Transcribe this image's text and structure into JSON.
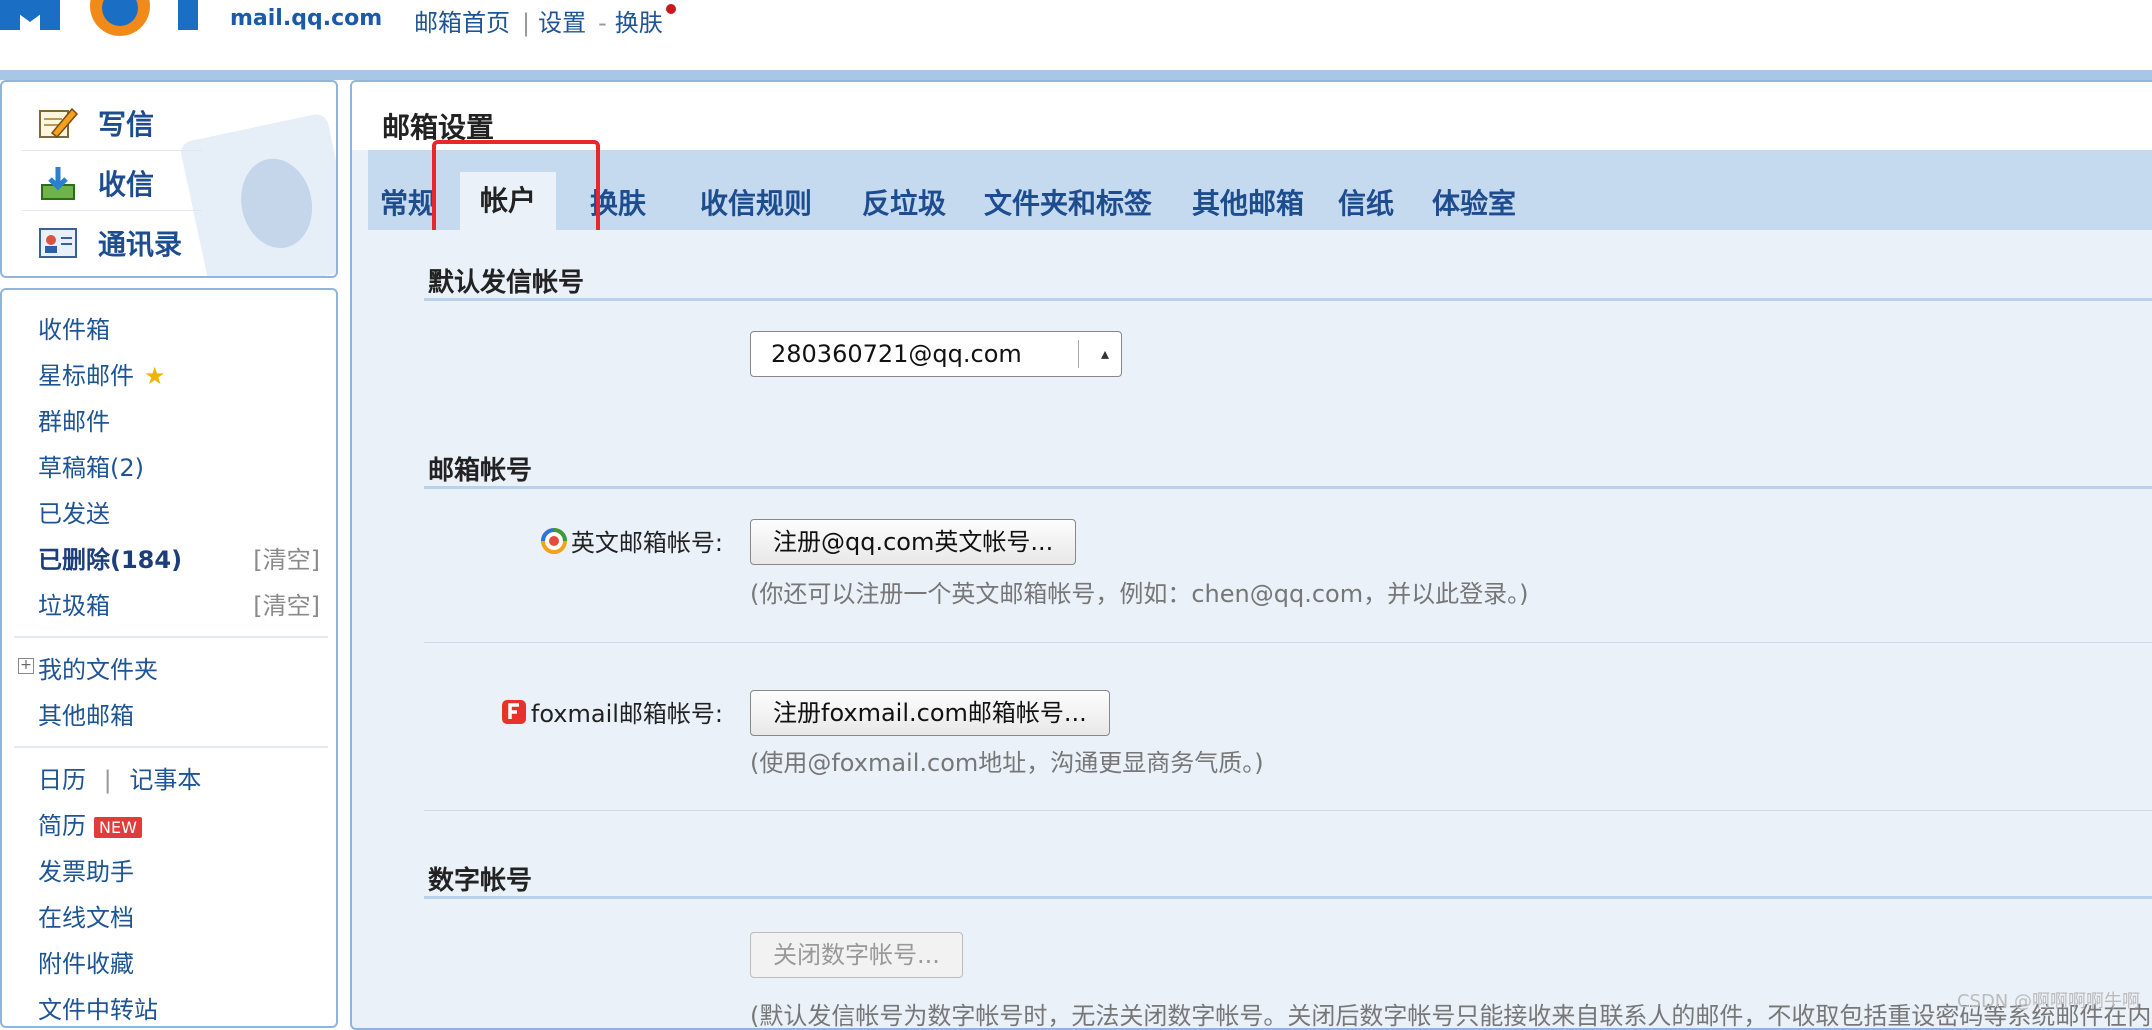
{
  "header": {
    "logo_text": "mail.qq.com",
    "links": [
      "邮箱首页",
      "设置",
      "换肤"
    ]
  },
  "quick": {
    "compose": "写信",
    "receive": "收信",
    "contacts": "通讯录"
  },
  "nav": {
    "inbox": "收件箱",
    "starred": "星标邮件",
    "group": "群邮件",
    "drafts": "草稿箱(2)",
    "sent": "已发送",
    "deleted": "已删除(184)",
    "deleted_clear": "[清空]",
    "spam": "垃圾箱",
    "spam_clear": "[清空]",
    "my_folders": "我的文件夹",
    "other_mail": "其他邮箱",
    "calendar": "日历",
    "calendar_sep": "|",
    "notes": "记事本",
    "resume": "简历",
    "resume_badge": "NEW",
    "invoice": "发票助手",
    "docs": "在线文档",
    "attachments": "附件收藏",
    "transfer": "文件中转站"
  },
  "main": {
    "title": "邮箱设置",
    "tabs": [
      "常规",
      "帐户",
      "换肤",
      "收信规则",
      "反垃圾",
      "文件夹和标签",
      "其他邮箱",
      "信纸",
      "体验室"
    ],
    "active_tab": "帐户"
  },
  "default_sender": {
    "title": "默认发信帐号",
    "value": "280360721@qq.com"
  },
  "mail_account": {
    "title": "邮箱帐号",
    "english_label": "英文邮箱帐号:",
    "english_button": "注册@qq.com英文帐号...",
    "english_hint": "(你还可以注册一个英文邮箱帐号，例如：chen@qq.com，并以此登录。)",
    "foxmail_label": "foxmail邮箱帐号:",
    "foxmail_button": "注册foxmail.com邮箱帐号...",
    "foxmail_hint": "(使用@foxmail.com地址，沟通更显商务气质。)"
  },
  "digital_account": {
    "title": "数字帐号",
    "button": "关闭数字帐号...",
    "hint": "(默认发信帐号为数字帐号时，无法关闭数字帐号。关闭后数字帐号只能接收来自联系人的邮件，不收取包括重设密码等系统邮件在内的"
  },
  "watermark": "CSDN @啊啊啊啊牛啊",
  "colors": {
    "accent": "#1e5494",
    "tab_bar": "#c5d9ef",
    "highlight": "#e8262c",
    "panel_bg": "#eaf1f9"
  }
}
